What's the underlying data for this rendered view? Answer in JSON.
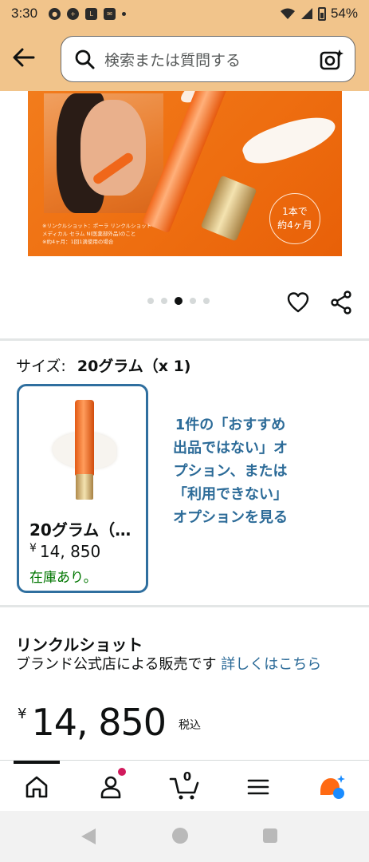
{
  "status_bar": {
    "time": "3:30",
    "battery": "54%",
    "icons": [
      "chrome-icon",
      "chat-icon",
      "line-icon",
      "mail-icon",
      "dot-icon",
      "wifi-icon",
      "signal-icon",
      "battery-icon"
    ]
  },
  "search": {
    "placeholder": "検索または質問する"
  },
  "hero": {
    "badge_line1": "1本で",
    "badge_line2": "約4ヶ月",
    "fine_line1": "※リンクルショット：ポーラ リンクルショット",
    "fine_line2": "メディカル セラム N(医薬部外品)のこと",
    "fine_line3": "※約4ヶ月：1回1滴使用の場合"
  },
  "carousel": {
    "count": 5,
    "active_index": 2
  },
  "size": {
    "label": "サイズ:",
    "value": "20グラム（x 1)",
    "card": {
      "name": "20グラム（…",
      "price_symbol": "¥",
      "price": "14, 850",
      "stock": "在庫あり。"
    },
    "options_link": "1件の「おすすめ出品ではない」オプション、または「利用できない」オプションを見る"
  },
  "seller": {
    "brand": "リンクルショット",
    "text": "ブランド公式店による販売です",
    "link": "詳しくはこちら"
  },
  "price": {
    "symbol": "¥",
    "amount": "14, 850",
    "tax": "税込"
  },
  "bottom_nav": {
    "cart_count": "0",
    "items": [
      "home-icon",
      "account-icon",
      "cart-icon",
      "menu-icon",
      "ai-assistant-icon"
    ]
  },
  "colors": {
    "header_bg": "#f1c48b",
    "link": "#2c6b98",
    "stock_green": "#007600",
    "selected_border": "#2f6f9f",
    "assistant_orange": "#ff6a13",
    "assistant_blue": "#1a8cff"
  }
}
